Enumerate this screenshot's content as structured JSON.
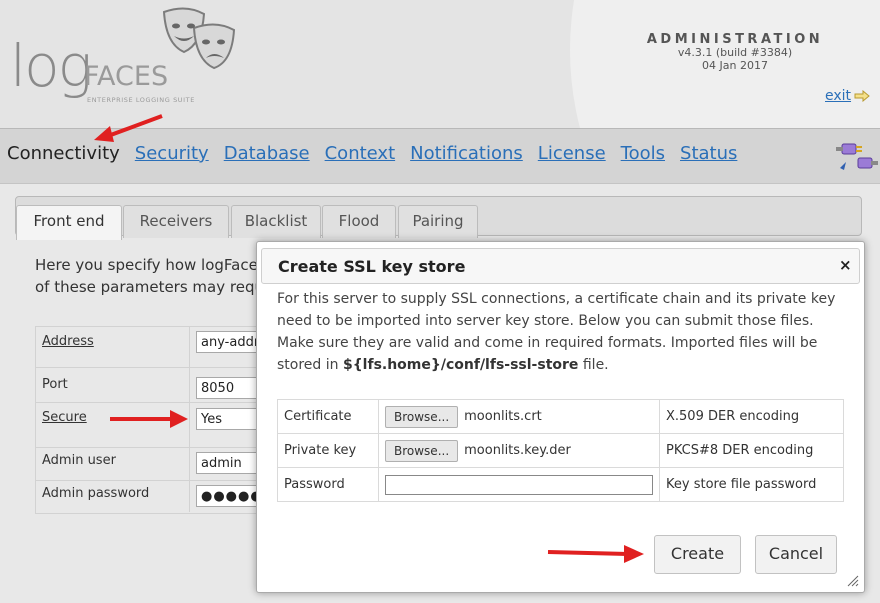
{
  "header": {
    "logo_log": "log",
    "logo_faces": "FACES",
    "logo_tagline": "ENTERPRISE LOGGING SUITE",
    "admin_title": "ADMINISTRATION",
    "version": "v4.3.1 (build #3384)",
    "date": "04 Jan 2017",
    "exit_label": "exit"
  },
  "nav": {
    "items": [
      "Connectivity",
      "Security",
      "Database",
      "Context",
      "Notifications",
      "License",
      "Tools",
      "Status"
    ],
    "active": "Connectivity"
  },
  "tabs": {
    "items": [
      "Front end",
      "Receivers",
      "Blacklist",
      "Flood",
      "Pairing"
    ],
    "active": "Front end"
  },
  "content": {
    "intro_line1": "Here you specify how logFaces",
    "intro_line2": "of these parameters may requ"
  },
  "form": {
    "address_label": "Address",
    "address_value": "any-addr",
    "port_label": "Port",
    "port_value": "8050",
    "secure_label": "Secure",
    "secure_value": "Yes",
    "admin_user_label": "Admin user",
    "admin_user_value": "admin",
    "admin_password_label": "Admin password",
    "admin_password_value": "●●●●●"
  },
  "dialog": {
    "title": "Create SSL key store",
    "close": "×",
    "desc_before": "For this server to supply SSL connections, a certificate chain and its private key need to be imported into server key store. Below you can submit those files. Make sure they are valid and come in required formats. Imported files will be stored in ",
    "desc_path": "${lfs.home}/conf/lfs-ssl-store",
    "desc_after": " file.",
    "rows": {
      "certificate": {
        "label": "Certificate",
        "browse": "Browse...",
        "file": "moonlits.crt",
        "note": "X.509 DER encoding"
      },
      "private_key": {
        "label": "Private key",
        "browse": "Browse...",
        "file": "moonlits.key.der",
        "note": "PKCS#8 DER encoding"
      },
      "password": {
        "label": "Password",
        "value": "",
        "note": "Key store file password"
      }
    },
    "create_label": "Create",
    "cancel_label": "Cancel"
  },
  "colors": {
    "link": "#2a6fb8",
    "arrow": "#e02020",
    "nav_bg": "#d4d4d4"
  },
  "icons": [
    "theatre-masks-icon",
    "exit-arrow-icon",
    "plug-connector-icon",
    "red-pointer-arrow-icon",
    "resize-grip-icon"
  ]
}
